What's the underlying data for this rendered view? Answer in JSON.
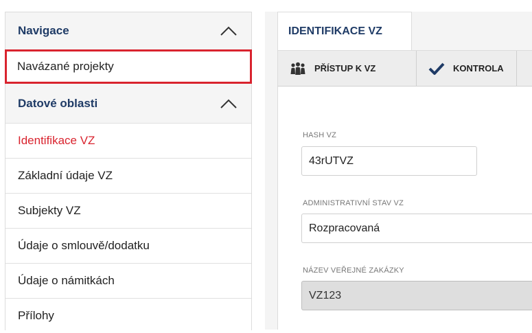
{
  "sidebar": {
    "navigation_header": "Navigace",
    "linked_projects": "Navázané projekty",
    "data_areas_header": "Datové oblasti",
    "items": [
      {
        "label": "Identifikace VZ",
        "active": true
      },
      {
        "label": "Základní údaje VZ",
        "active": false
      },
      {
        "label": "Subjekty VZ",
        "active": false
      },
      {
        "label": "Údaje o smlouvě/dodatku",
        "active": false
      },
      {
        "label": "Údaje o námitkách",
        "active": false
      },
      {
        "label": "Přílohy",
        "active": false
      }
    ]
  },
  "tabs": {
    "active_tab": "IDENTIFIKACE VZ"
  },
  "toolbar": {
    "access_label": "PŘÍSTUP K VZ",
    "check_label": "KONTROLA"
  },
  "form": {
    "hash_label": "HASH VZ",
    "hash_value": "43rUTVZ",
    "admin_state_label": "ADMINISTRATIVNÍ STAV VZ",
    "admin_state_value": "Rozpracovaná",
    "name_label": "NÁZEV VEŘEJNÉ ZAKÁZKY",
    "name_value": "VZ123"
  },
  "colors": {
    "header_text": "#1f3b66",
    "active_red": "#d9232e",
    "highlight_border": "#d9232e"
  }
}
